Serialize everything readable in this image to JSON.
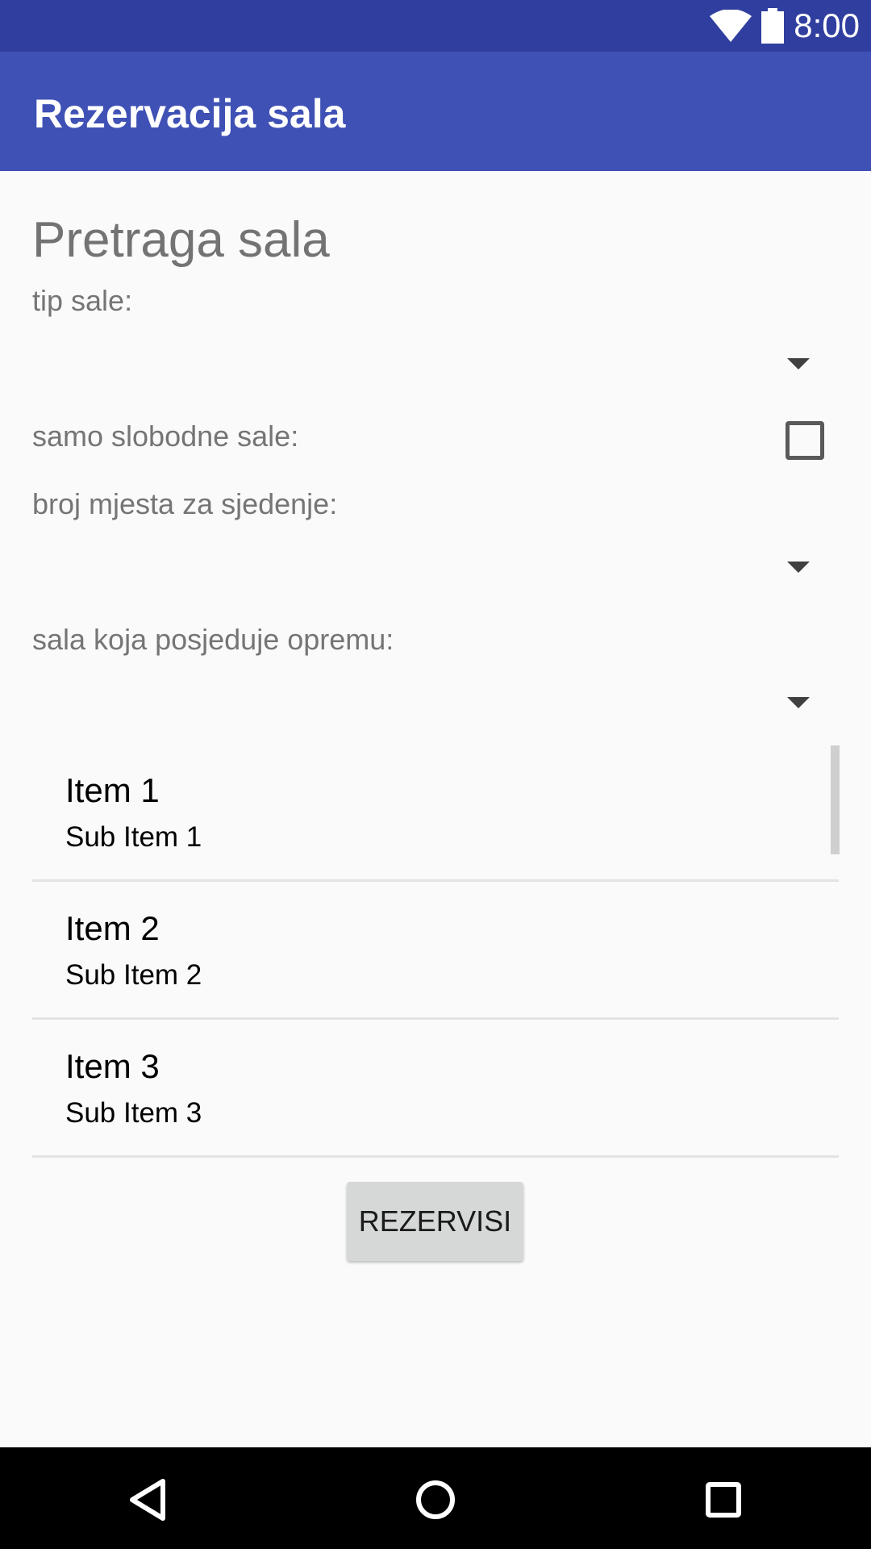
{
  "status_bar": {
    "time": "8:00",
    "icons": [
      "wifi-icon",
      "battery-icon"
    ],
    "color": "#303f9f"
  },
  "app_bar": {
    "title": "Rezervacija sala",
    "color": "#3f51b5"
  },
  "form": {
    "heading": "Pretraga sala",
    "room_type_label": "tip sale:",
    "free_only_label": "samo slobodne sale:",
    "free_only_checked": false,
    "seats_label": "broj mjesta za sjedenje:",
    "equipment_label": "sala koja posjeduje opremu:"
  },
  "list": {
    "items": [
      {
        "title": "Item 1",
        "subtitle": "Sub Item 1"
      },
      {
        "title": "Item 2",
        "subtitle": "Sub Item 2"
      },
      {
        "title": "Item 3",
        "subtitle": "Sub Item 3"
      }
    ]
  },
  "actions": {
    "reserve_label": "REZERVISI"
  },
  "nav_bar": {
    "icons": [
      "back-icon",
      "home-icon",
      "recents-icon"
    ]
  }
}
